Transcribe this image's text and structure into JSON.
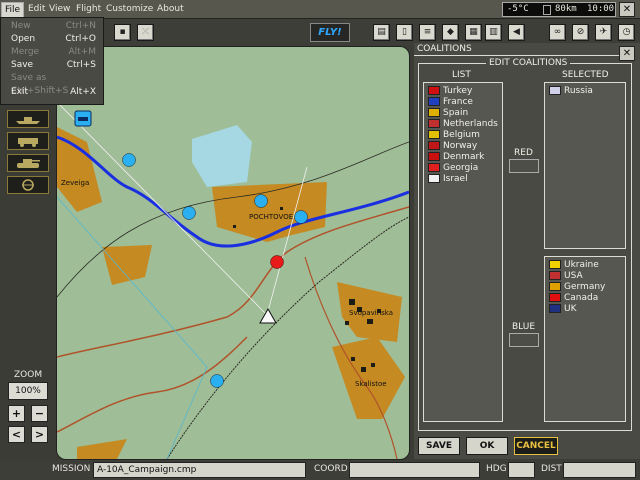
{
  "menubar": {
    "items": [
      {
        "label": "File"
      },
      {
        "label": "Edit"
      },
      {
        "label": "View"
      },
      {
        "label": "Flight"
      },
      {
        "label": "Customize"
      },
      {
        "label": "About"
      }
    ],
    "temperature": "-5°C",
    "distance_readout": "80km",
    "time_readout": "10:00"
  },
  "file_menu": [
    {
      "label": "New",
      "shortcut": "Ctrl+N",
      "enabled": false
    },
    {
      "label": "Open",
      "shortcut": "Ctrl+O",
      "enabled": true
    },
    {
      "label": "Merge",
      "shortcut": "Alt+M",
      "enabled": false
    },
    {
      "label": "Save",
      "shortcut": "Ctrl+S",
      "enabled": true
    },
    {
      "label": "Save as Ctrl+Shift+S",
      "shortcut": "",
      "enabled": false
    },
    {
      "label": "Exit",
      "shortcut": "Alt+X",
      "enabled": true
    }
  ],
  "toolbar": {
    "fly_label": "FLY!"
  },
  "zoom": {
    "label": "ZOOM",
    "value": "100%",
    "plus": "+",
    "minus": "−",
    "left": "<",
    "right": ">"
  },
  "map": {
    "towns": [
      {
        "label": "Zeveiga"
      },
      {
        "label": "POCHTOVOE"
      },
      {
        "label": "Svopavinska"
      },
      {
        "label": "Skalistoe"
      }
    ]
  },
  "coalitions": {
    "panel_title": "COALITIONS",
    "edit_title": "EDIT COALITIONS",
    "list_header": "LIST",
    "selected_header": "SELECTED",
    "red_label": "RED",
    "blue_label": "BLUE",
    "list": [
      {
        "name": "Turkey",
        "flag": "#d01010"
      },
      {
        "name": "France",
        "flag": "#2040c0"
      },
      {
        "name": "Spain",
        "flag": "#e0b000"
      },
      {
        "name": "Netherlands",
        "flag": "#c03030"
      },
      {
        "name": "Belgium",
        "flag": "#e0c000"
      },
      {
        "name": "Norway",
        "flag": "#c01818"
      },
      {
        "name": "Denmark",
        "flag": "#c81010"
      },
      {
        "name": "Georgia",
        "flag": "#e02020"
      },
      {
        "name": "Israel",
        "flag": "#f0f0f0"
      }
    ],
    "red_selected": [
      {
        "name": "Russia",
        "flag": "#d0d0e8"
      }
    ],
    "blue_selected": [
      {
        "name": "Ukraine",
        "flag": "#f0d000"
      },
      {
        "name": "USA",
        "flag": "#c03030"
      },
      {
        "name": "Germany",
        "flag": "#e0a000"
      },
      {
        "name": "Canada",
        "flag": "#e01010"
      },
      {
        "name": "UK",
        "flag": "#203080"
      }
    ],
    "buttons": {
      "save": "SAVE",
      "ok": "OK",
      "cancel": "CANCEL"
    }
  },
  "statusbar": {
    "mission_label": "MISSION",
    "mission_value": "A-10A_Campaign.cmp",
    "coord_label": "COORD",
    "hdg_label": "HDG",
    "dist_label": "DIST"
  }
}
